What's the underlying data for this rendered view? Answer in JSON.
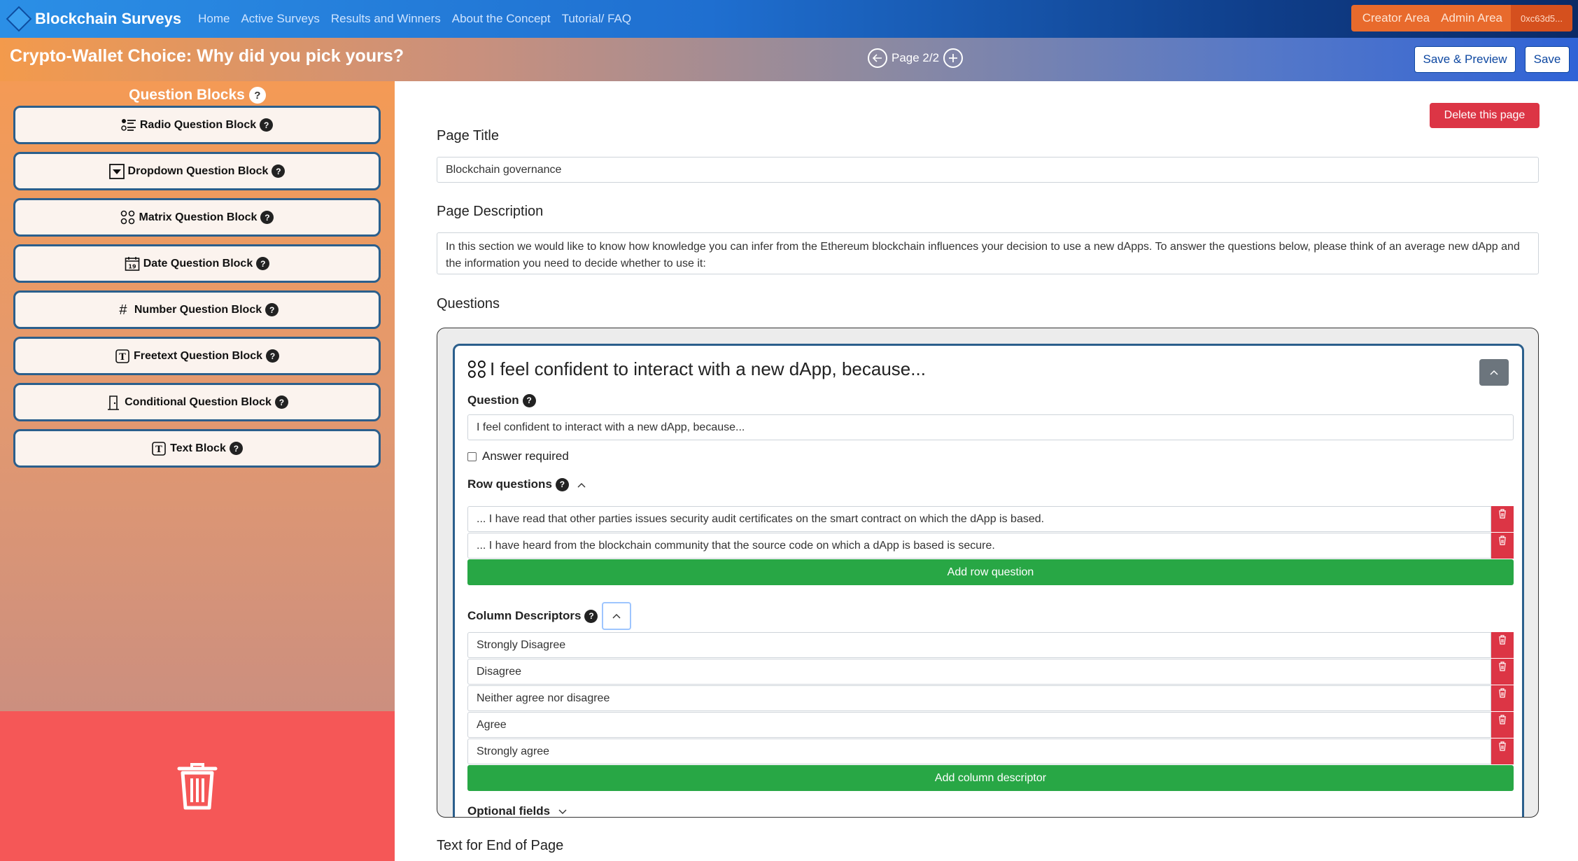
{
  "nav": {
    "brand": "Blockchain Surveys",
    "links": [
      "Home",
      "Active Surveys",
      "Results and Winners",
      "About the Concept",
      "Tutorial/ FAQ"
    ],
    "creator_area": "Creator Area",
    "admin_area": "Admin Area",
    "address": "0xc63d5..."
  },
  "titlebar": {
    "survey_title": "Crypto-Wallet Choice: Why did you pick yours?",
    "page_indicator": "Page 2/2",
    "save_preview": "Save & Preview",
    "save": "Save"
  },
  "sidebar": {
    "heading": "Question Blocks",
    "help": "?",
    "blocks": [
      {
        "label": "Radio Question Block",
        "icon": "radio-list-icon"
      },
      {
        "label": "Dropdown Question Block",
        "icon": "dropdown-icon"
      },
      {
        "label": "Matrix Question Block",
        "icon": "matrix-icon"
      },
      {
        "label": "Date Question Block",
        "icon": "calendar-icon",
        "icon_text": "19"
      },
      {
        "label": "Number Question Block",
        "icon": "hash-icon",
        "icon_text": "#"
      },
      {
        "label": "Freetext Question Block",
        "icon": "freetext-icon",
        "icon_text": "T"
      },
      {
        "label": "Conditional Question Block",
        "icon": "door-icon"
      },
      {
        "label": "Text Block",
        "icon": "textblock-icon",
        "icon_text": "T"
      }
    ]
  },
  "main": {
    "delete_page": "Delete this page",
    "page_title_label": "Page Title",
    "page_title_value": "Blockchain governance",
    "page_desc_label": "Page Description",
    "page_desc_value": "In this section we would like to know how knowledge you can infer from the Ethereum blockchain influences your decision to use a new dApps. To answer the questions below, please think of an average new dApp and the information you need to decide whether to use it:",
    "questions_label": "Questions",
    "end_text_label": "Text for End of Page",
    "question": {
      "title": "I feel confident to interact with a new dApp, because...",
      "question_label": "Question",
      "question_value": "I feel confident to interact with a new dApp, because...",
      "answer_required": "Answer required",
      "row_questions_label": "Row questions",
      "rows": [
        "... I have read that other parties issues security audit certificates on the smart contract on which the dApp is based.",
        "... I have heard from the blockchain community that the source code on which a dApp is based is secure."
      ],
      "add_row": "Add row question",
      "column_label": "Column Descriptors",
      "columns": [
        "Strongly Disagree",
        "Disagree",
        "Neither agree nor disagree",
        "Agree",
        "Strongly agree"
      ],
      "add_column": "Add column descriptor",
      "optional_fields": "Optional fields"
    }
  },
  "colors": {
    "accent_blue": "#2b5f8c",
    "danger": "#dc3545",
    "success": "#28a745",
    "trash_zone": "#f55757"
  }
}
